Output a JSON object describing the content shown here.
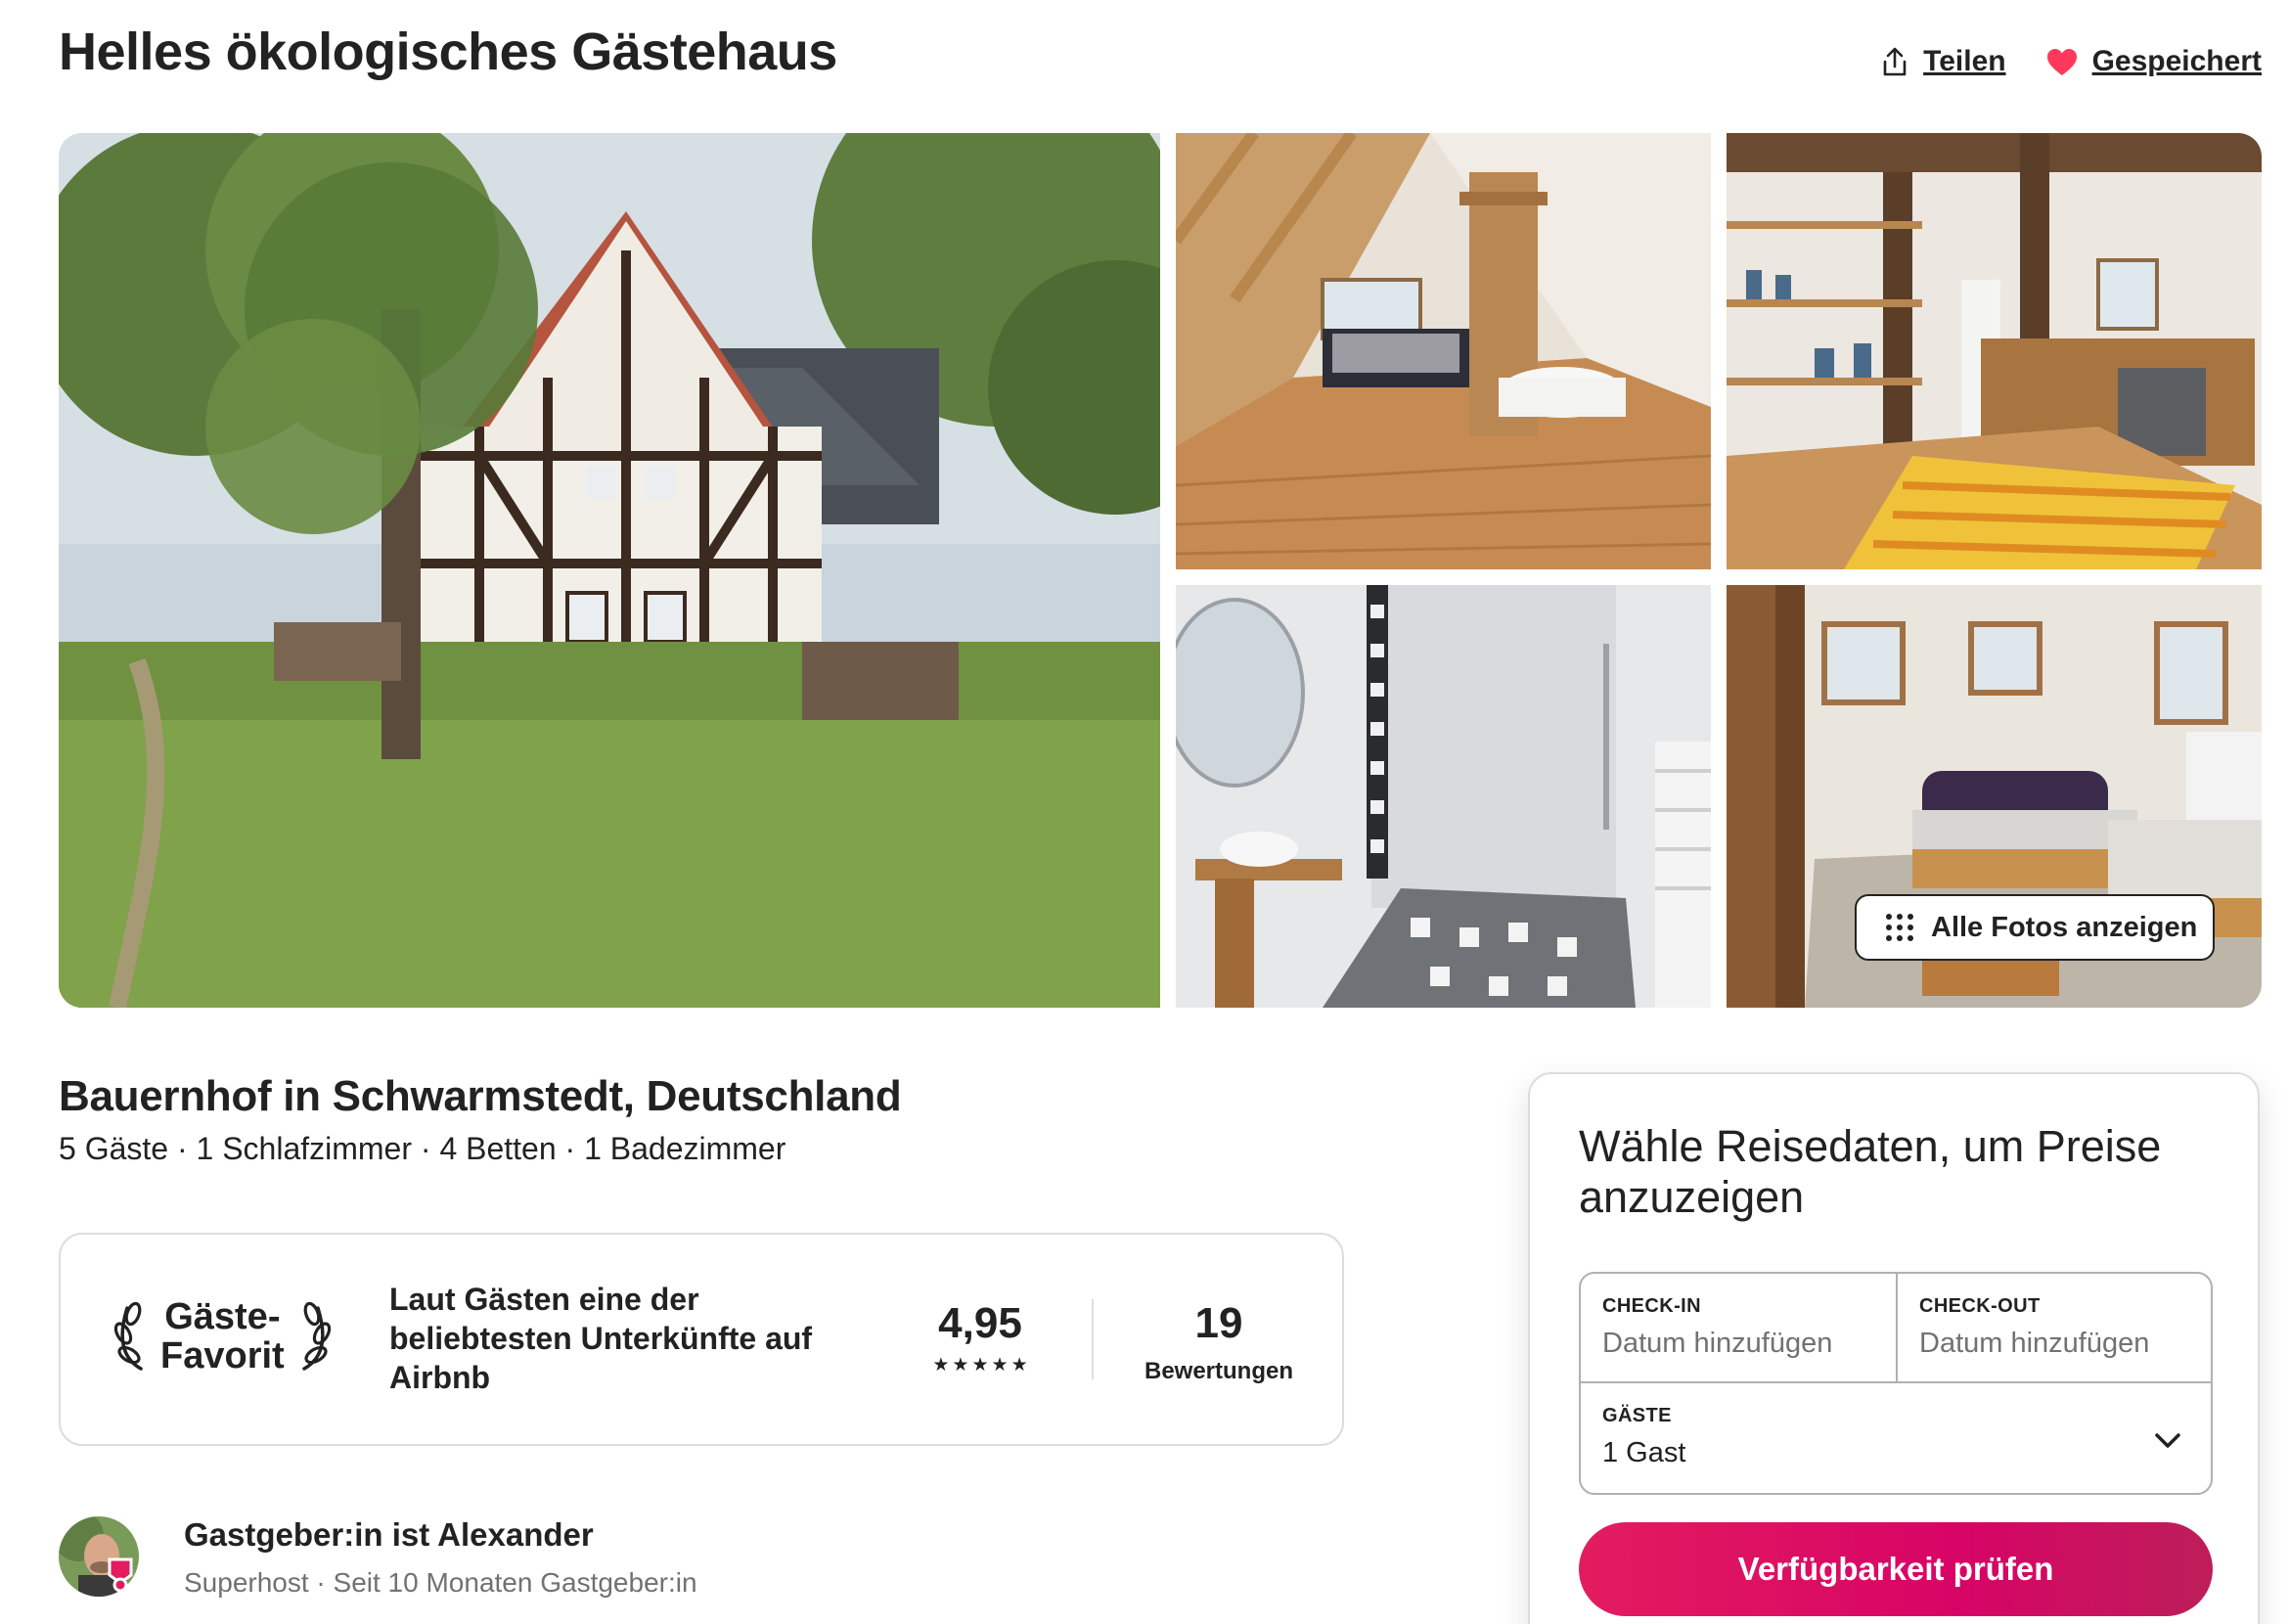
{
  "listing": {
    "title": "Helles ökologisches Gästehaus",
    "share_label": "Teilen",
    "saved_label": "Gespeichert",
    "all_photos_label": "Alle Fotos anzeigen",
    "subtitle": "Bauernhof in Schwarmstedt, Deutschland",
    "details": "5 Gäste · 1 Schlafzimmer · 4 Betten · 1 Badezimmer"
  },
  "guest_favorite": {
    "badge": "Gäste-\nFavorit",
    "description": "Laut Gästen eine der beliebtesten Unterkünfte auf Airbnb",
    "rating": "4,95",
    "stars": 5,
    "reviews_count": "19",
    "reviews_label": "Bewertungen"
  },
  "host": {
    "name": "Gastgeber:in ist Alexander",
    "subtitle": "Superhost · Seit 10 Monaten Gastgeber:in"
  },
  "booking": {
    "heading": "Wähle Reisedaten, um Preise anzuzeigen",
    "checkin_label": "CHECK-IN",
    "checkin_value": "Datum hinzufügen",
    "checkout_label": "CHECK-OUT",
    "checkout_value": "Datum hinzufügen",
    "guests_label": "GÄSTE",
    "guests_value": "1 Gast",
    "button_label": "Verfügbarkeit prüfen"
  },
  "colors": {
    "brand": "#e31c5f",
    "heart": "#ff385c",
    "text": "#222222",
    "muted": "#717171",
    "border": "#dddddd"
  },
  "icons": [
    "share-icon",
    "heart-icon",
    "grid-dots-icon",
    "laurel-icon",
    "star-icon",
    "chevron-down-icon",
    "superhost-badge-icon"
  ]
}
